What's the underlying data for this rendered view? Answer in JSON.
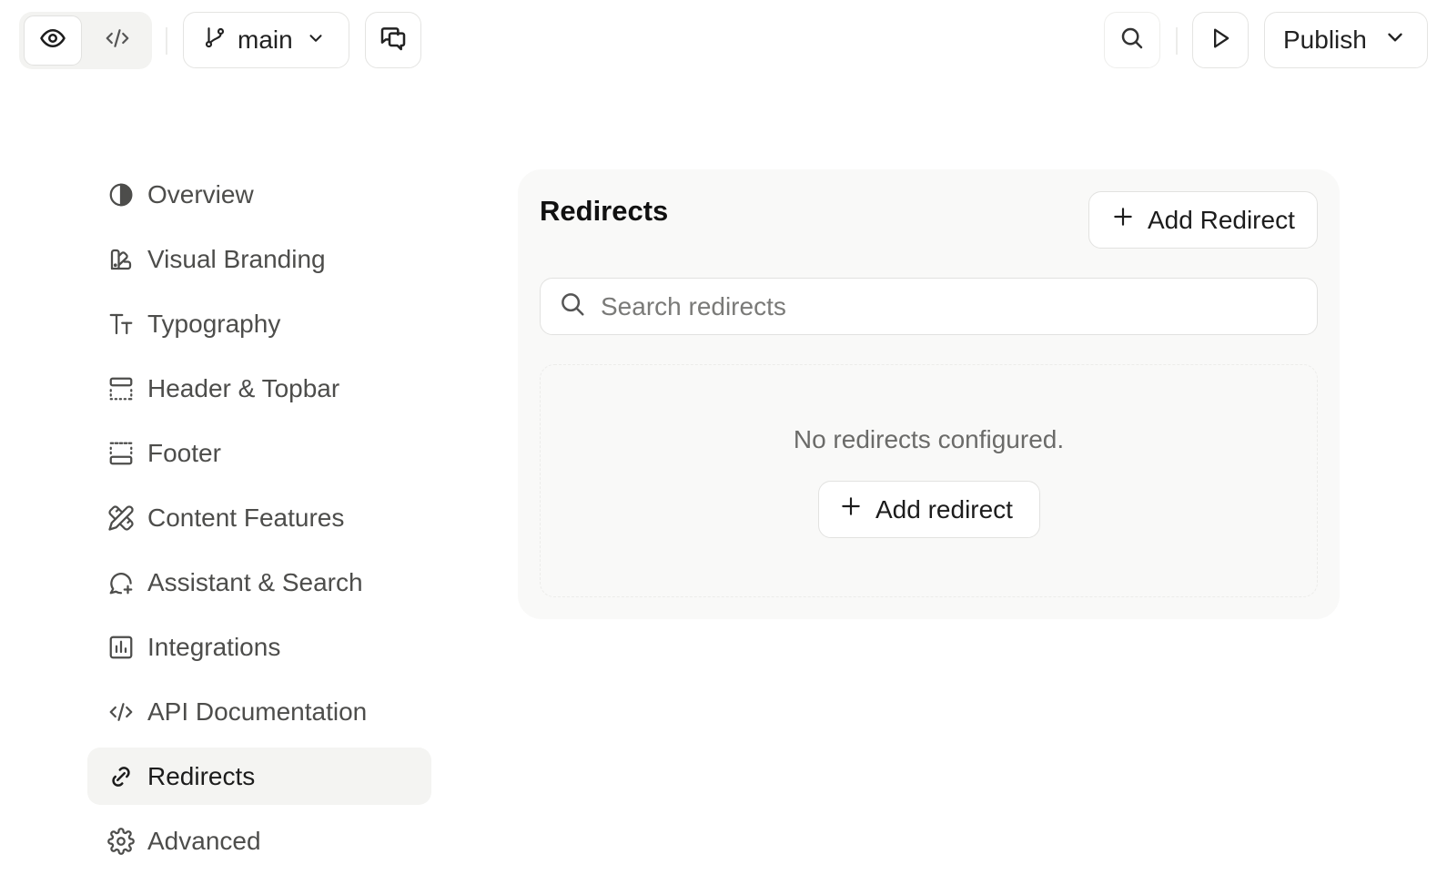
{
  "toolbar": {
    "preview_icon": "eye-icon",
    "code_icon": "code-icon",
    "branch": {
      "icon": "git-branch-icon",
      "label": "main"
    },
    "chat_icon": "chat-bubbles-icon",
    "search_icon": "search-icon",
    "play_icon": "play-icon",
    "publish": {
      "label": "Publish"
    }
  },
  "sidebar": {
    "items": [
      {
        "label": "Overview",
        "icon": "contrast-circle-icon"
      },
      {
        "label": "Visual Branding",
        "icon": "palette-icon"
      },
      {
        "label": "Typography",
        "icon": "text-size-icon"
      },
      {
        "label": "Header & Topbar",
        "icon": "layout-header-icon"
      },
      {
        "label": "Footer",
        "icon": "layout-footer-icon"
      },
      {
        "label": "Content Features",
        "icon": "pencil-ruler-icon"
      },
      {
        "label": "Assistant & Search",
        "icon": "chat-sparkle-icon"
      },
      {
        "label": "Integrations",
        "icon": "bar-chart-icon"
      },
      {
        "label": "API Documentation",
        "icon": "code-icon"
      },
      {
        "label": "Redirects",
        "icon": "link-icon",
        "active": true
      },
      {
        "label": "Advanced",
        "icon": "gear-icon"
      }
    ]
  },
  "main": {
    "title": "Redirects",
    "add_button_label": "Add Redirect",
    "search": {
      "placeholder": "Search redirects",
      "value": ""
    },
    "empty_state": {
      "message": "No redirects configured.",
      "button_label": "Add redirect"
    }
  },
  "colors": {
    "panel_bg": "#f9f9f8",
    "active_nav_bg": "#f4f4f2",
    "border": "#e2e2e0",
    "muted_text": "#6b6b69"
  }
}
